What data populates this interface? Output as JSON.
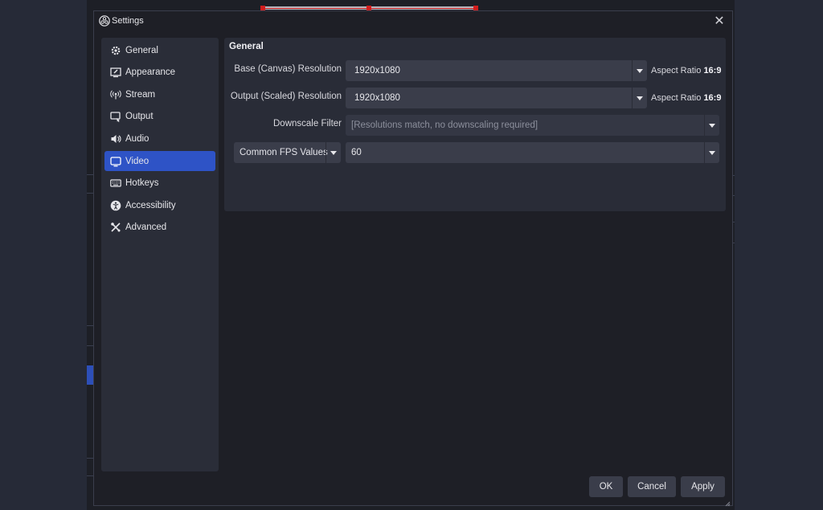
{
  "window": {
    "title": "Settings",
    "close_icon": "close-icon"
  },
  "sidebar": {
    "items": [
      {
        "label": "General",
        "icon": "gear-icon"
      },
      {
        "label": "Appearance",
        "icon": "appearance-icon"
      },
      {
        "label": "Stream",
        "icon": "broadcast-icon"
      },
      {
        "label": "Output",
        "icon": "output-icon"
      },
      {
        "label": "Audio",
        "icon": "speaker-icon"
      },
      {
        "label": "Video",
        "icon": "monitor-icon",
        "active": true
      },
      {
        "label": "Hotkeys",
        "icon": "keyboard-icon"
      },
      {
        "label": "Accessibility",
        "icon": "accessibility-icon"
      },
      {
        "label": "Advanced",
        "icon": "tools-icon"
      }
    ]
  },
  "general": {
    "title": "General",
    "base_resolution": {
      "label": "Base (Canvas) Resolution",
      "value": "1920x1080",
      "aspect_label": "Aspect Ratio",
      "aspect_value": "16:9"
    },
    "output_resolution": {
      "label": "Output (Scaled) Resolution",
      "value": "1920x1080",
      "aspect_label": "Aspect Ratio",
      "aspect_value": "16:9"
    },
    "downscale_filter": {
      "label": "Downscale Filter",
      "value": "[Resolutions match, no downscaling required]"
    },
    "fps": {
      "type_label": "Common FPS Values",
      "value": "60"
    }
  },
  "footer": {
    "ok": "OK",
    "cancel": "Cancel",
    "apply": "Apply"
  },
  "colors": {
    "accent": "#2e53c6",
    "background": "#1e1f26",
    "panel": "#292c37",
    "preview_selection": "#d01d1d"
  }
}
